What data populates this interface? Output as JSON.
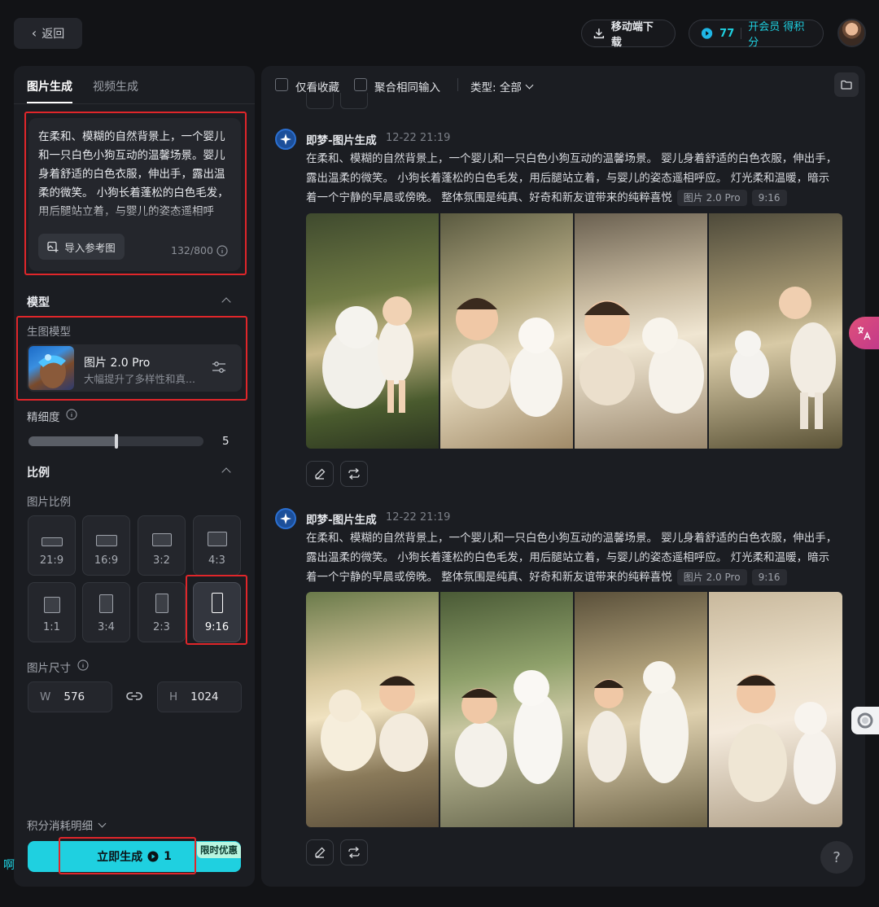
{
  "header": {
    "back_label": "返回",
    "mobile_download_label": "移动端下载",
    "points_value": "77",
    "membership_label": "开会员 得积分"
  },
  "left": {
    "tabs": [
      {
        "label": "图片生成",
        "active": true
      },
      {
        "label": "视频生成",
        "active": false
      }
    ],
    "prompt": {
      "text": "在柔和、模糊的自然背景上，一个婴儿和一只白色小狗互动的温馨场景。婴儿身着舒适的白色衣服，伸出手，露出温柔的微笑。 小狗长着蓬松的白色毛发，用后腿站立着，与婴儿的姿态遥相呼应。 灯光柔和温暖，暗示着一个宁静的早晨或傍晚。",
      "import_label": "导入参考图",
      "counter": "132/800"
    },
    "model_section": {
      "title": "模型",
      "sub_label": "生图模型",
      "model_name": "图片 2.0 Pro",
      "model_desc": "大幅提升了多样性和真..."
    },
    "detail": {
      "label": "精细度",
      "value": "5",
      "fraction": 0.5
    },
    "ratio_section": {
      "title": "比例",
      "sub_label": "图片比例",
      "ratios": [
        {
          "label": "21:9",
          "selected": false
        },
        {
          "label": "16:9",
          "selected": false
        },
        {
          "label": "3:2",
          "selected": false
        },
        {
          "label": "4:3",
          "selected": false
        },
        {
          "label": "1:1",
          "selected": false
        },
        {
          "label": "3:4",
          "selected": false
        },
        {
          "label": "2:3",
          "selected": false
        },
        {
          "label": "9:16",
          "selected": true
        }
      ]
    },
    "size": {
      "label": "图片尺寸",
      "w_label": "W",
      "w_value": "576",
      "h_label": "H",
      "h_value": "1024"
    },
    "cost_detail_label": "积分消耗明细",
    "generate": {
      "label": "立即生成",
      "cost": "1",
      "promo": "限时优惠"
    },
    "stray_char": "啊"
  },
  "right": {
    "toolbar": {
      "favorites_label": "仅看收藏",
      "merge_label": "聚合相同输入",
      "type_label": "类型: 全部"
    },
    "results": [
      {
        "bot_name": "即梦-图片生成",
        "time": "12-22  21:19",
        "description": "在柔和、模糊的自然背景上，一个婴儿和一只白色小狗互动的温馨场景。 婴儿身着舒适的白色衣服，伸出手，露出温柔的微笑。 小狗长着蓬松的白色毛发，用后腿站立着，与婴儿的姿态遥相呼应。 灯光柔和温暖，暗示着一个宁静的早晨或傍晚。 整体氛围是纯真、好奇和新友谊带来的纯粹喜悦",
        "model_tag": "图片 2.0 Pro",
        "ratio_tag": "9:16"
      },
      {
        "bot_name": "即梦-图片生成",
        "time": "12-22  21:19",
        "description": "在柔和、模糊的自然背景上，一个婴儿和一只白色小狗互动的温馨场景。 婴儿身着舒适的白色衣服，伸出手，露出温柔的微笑。 小狗长着蓬松的白色毛发，用后腿站立着，与婴儿的姿态遥相呼应。 灯光柔和温暖，暗示着一个宁静的早晨或傍晚。 整体氛围是纯真、好奇和新友谊带来的纯粹喜悦",
        "model_tag": "图片 2.0 Pro",
        "ratio_tag": "9:16"
      }
    ],
    "help_label": "?"
  }
}
